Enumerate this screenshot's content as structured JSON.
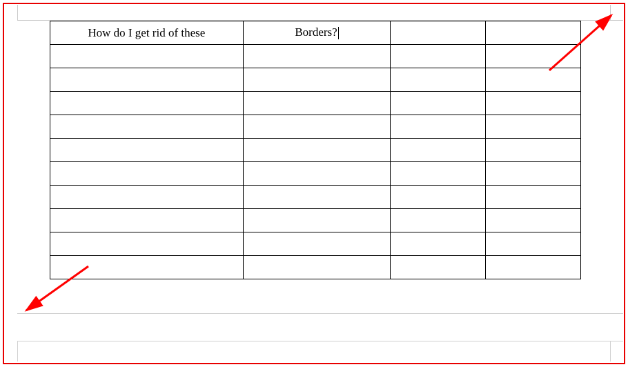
{
  "annotations": {
    "frame_color": "#e80000",
    "arrow_color": "#ff0000"
  },
  "table": {
    "columns": 4,
    "rows": [
      {
        "cells": [
          "How do I get rid of these",
          "Borders?",
          "",
          ""
        ]
      },
      {
        "cells": [
          "",
          "",
          "",
          ""
        ]
      },
      {
        "cells": [
          "",
          "",
          "",
          ""
        ]
      },
      {
        "cells": [
          "",
          "",
          "",
          ""
        ]
      },
      {
        "cells": [
          "",
          "",
          "",
          ""
        ]
      },
      {
        "cells": [
          "",
          "",
          "",
          ""
        ]
      },
      {
        "cells": [
          "",
          "",
          "",
          ""
        ]
      },
      {
        "cells": [
          "",
          "",
          "",
          ""
        ]
      },
      {
        "cells": [
          "",
          "",
          "",
          ""
        ]
      },
      {
        "cells": [
          "",
          "",
          "",
          ""
        ]
      },
      {
        "cells": [
          "",
          "",
          "",
          ""
        ]
      }
    ],
    "cursor": {
      "row": 0,
      "col": 1
    }
  }
}
